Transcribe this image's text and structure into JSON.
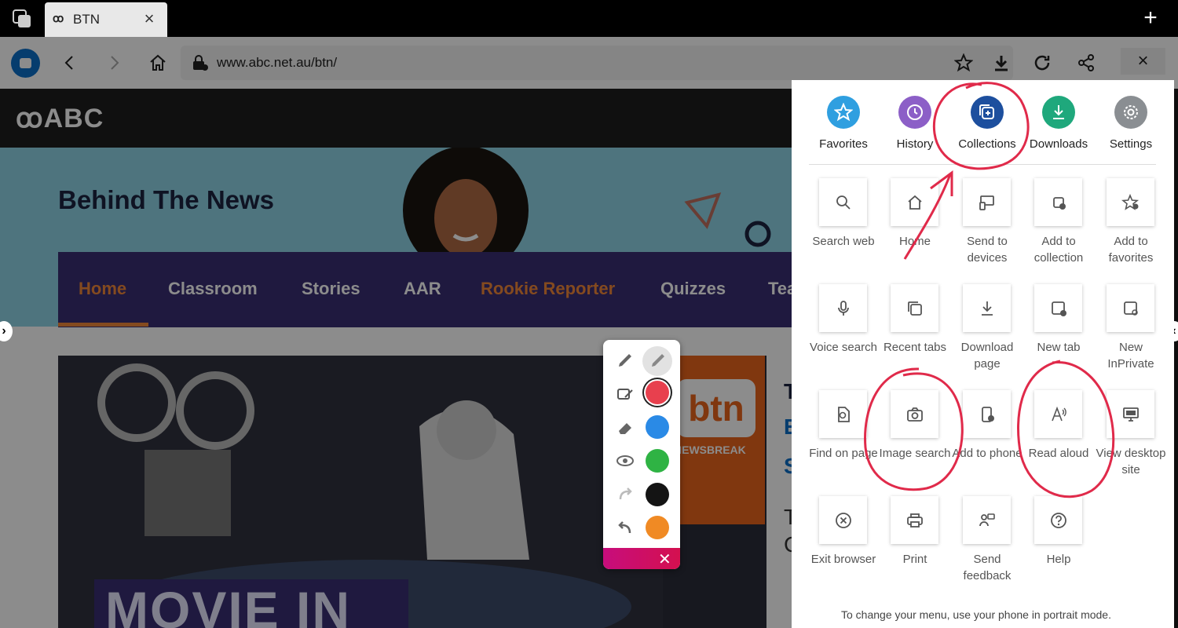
{
  "tab": {
    "logo": "ꝏ",
    "title": "BTN"
  },
  "address": {
    "url": "www.abc.net.au/btn/"
  },
  "abc": {
    "logo": "ꝏABC"
  },
  "hero": {
    "title": "Behind The News"
  },
  "nav": {
    "items": [
      "Home",
      "Classroom",
      "Stories",
      "AAR",
      "Rookie Reporter",
      "Quizzes",
      "Tea"
    ]
  },
  "card": {
    "btn_logo": "btn",
    "newsbreak": "NEWSBREAK",
    "movie_text": "MOVIE IN"
  },
  "menu": {
    "top_items": [
      "Favorites",
      "History",
      "Collections",
      "Downloads",
      "Settings"
    ],
    "grid_items": [
      "Search web",
      "Home",
      "Send to devices",
      "Add to collection",
      "Add to favorites",
      "Voice search",
      "Recent tabs",
      "Download page",
      "New tab",
      "New InPrivate",
      "Find on page",
      "Image search",
      "Add to phone",
      "Read aloud",
      "View desktop site",
      "Exit browser",
      "Print",
      "Send feedback",
      "Help"
    ],
    "footer": "To change your menu, use your phone in portrait mode."
  },
  "palette": {
    "colors": [
      "#e8404e",
      "#2a8ae6",
      "#2fb344",
      "#141414",
      "#f08a24"
    ]
  },
  "colors": {
    "favorites": "#2f9fe0",
    "history": "#8c5fc7",
    "collections": "#1d4f9e",
    "downloads": "#1fa87c",
    "settings": "#8a8e92",
    "ink": "#e02a4a"
  }
}
